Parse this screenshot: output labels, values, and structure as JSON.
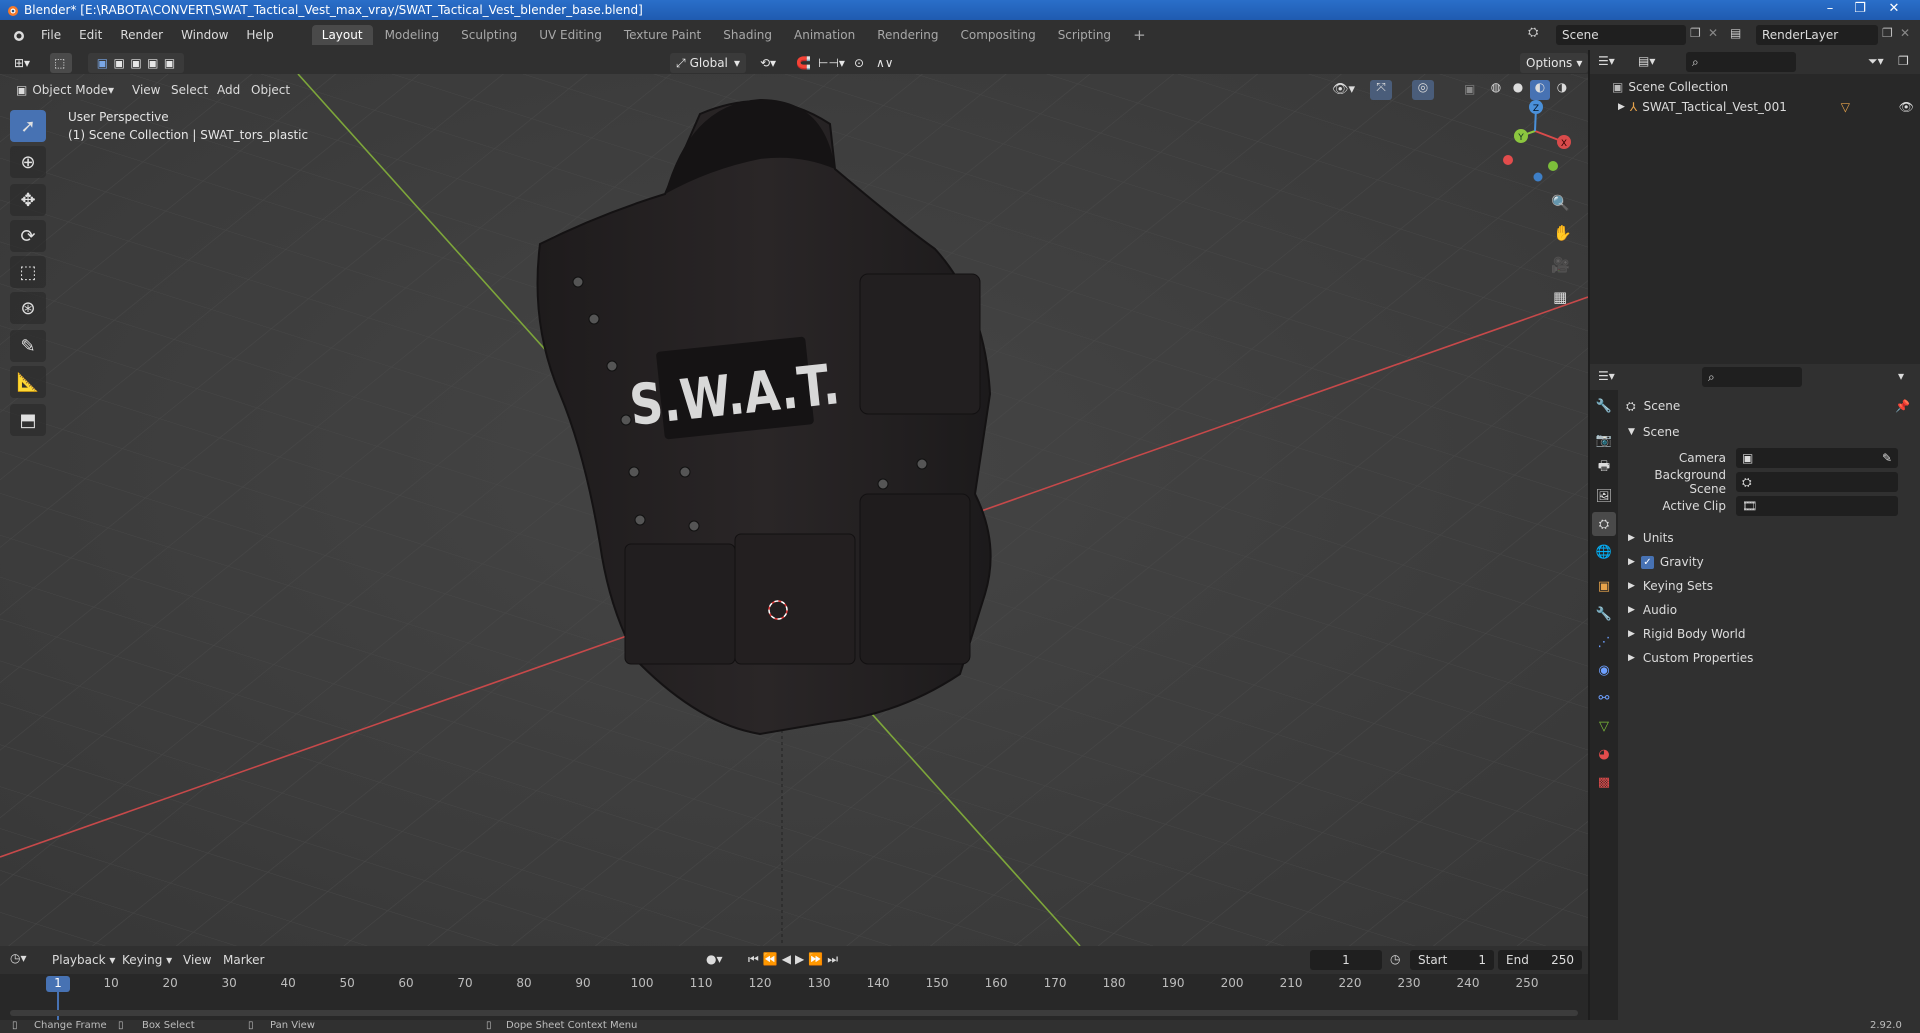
{
  "window": {
    "title": "Blender* [E:\\RABOTA\\CONVERT\\SWAT_Tactical_Vest_max_vray/SWAT_Tactical_Vest_blender_base.blend]"
  },
  "menu": {
    "items": [
      "File",
      "Edit",
      "Render",
      "Window",
      "Help"
    ]
  },
  "workspaces": [
    "Layout",
    "Modeling",
    "Sculpting",
    "UV Editing",
    "Texture Paint",
    "Shading",
    "Animation",
    "Rendering",
    "Compositing",
    "Scripting"
  ],
  "scene_selector": {
    "value": "Scene"
  },
  "renderlayer_selector": {
    "value": "RenderLayer"
  },
  "viewport_header": {
    "mode": "Object Mode",
    "menus": [
      "View",
      "Select",
      "Add",
      "Object"
    ],
    "transform_orientation": "Global",
    "options_label": "Options"
  },
  "viewport": {
    "perspective_label": "User Perspective",
    "collection_label": "(1) Scene Collection | SWAT_tors_plastic",
    "vest_text": "S.W.A.T.",
    "gizmo_axes": {
      "x": "X",
      "y": "Y",
      "z": "Z"
    }
  },
  "outliner": {
    "root": "Scene Collection",
    "items": [
      {
        "name": "SWAT_Tactical_Vest_001"
      }
    ]
  },
  "properties": {
    "context_title": "Scene",
    "panel_title": "Scene",
    "fields": [
      {
        "label": "Camera",
        "value": ""
      },
      {
        "label": "Background Scene",
        "value": ""
      },
      {
        "label": "Active Clip",
        "value": ""
      }
    ],
    "sections": [
      "Units",
      "Gravity",
      "Keying Sets",
      "Audio",
      "Rigid Body World",
      "Custom Properties"
    ],
    "gravity_checked": true
  },
  "timeline": {
    "menus": [
      "Playback",
      "Keying",
      "View",
      "Marker"
    ],
    "current_frame": "1",
    "start_label": "Start",
    "start_value": "1",
    "end_label": "End",
    "end_value": "250",
    "ruler": [
      "1",
      "10",
      "20",
      "30",
      "40",
      "50",
      "60",
      "70",
      "80",
      "90",
      "100",
      "110",
      "120",
      "130",
      "140",
      "150",
      "160",
      "170",
      "180",
      "190",
      "200",
      "210",
      "220",
      "230",
      "240",
      "250"
    ]
  },
  "statusbar": {
    "items": [
      "Change Frame",
      "Box Select",
      "Pan View",
      "Dope Sheet Context Menu"
    ],
    "version": "2.92.0"
  },
  "colors": {
    "accent": "#4772b3",
    "x_axis": "#d94b4b",
    "y_axis": "#8cc63f",
    "z_axis": "#4a90d9"
  }
}
